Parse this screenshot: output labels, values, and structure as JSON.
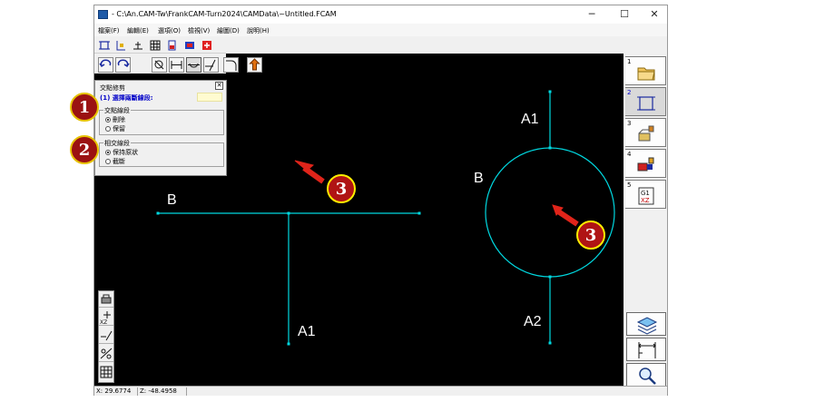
{
  "window": {
    "title": "- C:\\An.CAM-Tw\\FrankCAM-Turn2024\\CAMData\\~Untitled.FCAM",
    "minimize": "─",
    "maximize": "☐",
    "close": "✕"
  },
  "menu": [
    "檔案(F)",
    "編輯(E)",
    "選項(O)",
    "檢視(V)",
    "繪圖(D)",
    "說明(H)"
  ],
  "panel": {
    "title": "交點修剪",
    "close": "✕",
    "prompt": "(1) 選擇兩斷線段:",
    "group1": {
      "label": "交點線段",
      "options": [
        "刪除",
        "保留"
      ],
      "selected": 0
    },
    "group2": {
      "label": "相交線段",
      "options": [
        "保持原狀",
        "截斷"
      ],
      "selected": 0
    }
  },
  "canvas_labels": {
    "left_top": "B",
    "left_bottom": "A1",
    "right_top": "A1",
    "right_left": "B",
    "right_bottom": "A2"
  },
  "tabs": [
    {
      "num": "1",
      "icon": "folder-icon"
    },
    {
      "num": "2",
      "icon": "rectangle-select-icon",
      "active": true
    },
    {
      "num": "3",
      "icon": "part-setup-icon"
    },
    {
      "num": "4",
      "icon": "tool-holder-icon"
    },
    {
      "num": "5",
      "icon": "gcode-icon",
      "text": "G1\nXZ"
    }
  ],
  "tab5_text": {
    "line1": "G1",
    "line2": "XZ"
  },
  "right_buttons": [
    "layers-icon",
    "dimension-icon",
    "zoom-icon"
  ],
  "status": {
    "x": "X: 29.6774",
    "z": "Z: -48.4958"
  },
  "callouts": [
    "1",
    "2",
    "3",
    "3"
  ],
  "colors": {
    "geometry": "#00d8e0",
    "canvas_bg": "#000000",
    "label": "#ffffff",
    "arrow": "#e0241a"
  }
}
